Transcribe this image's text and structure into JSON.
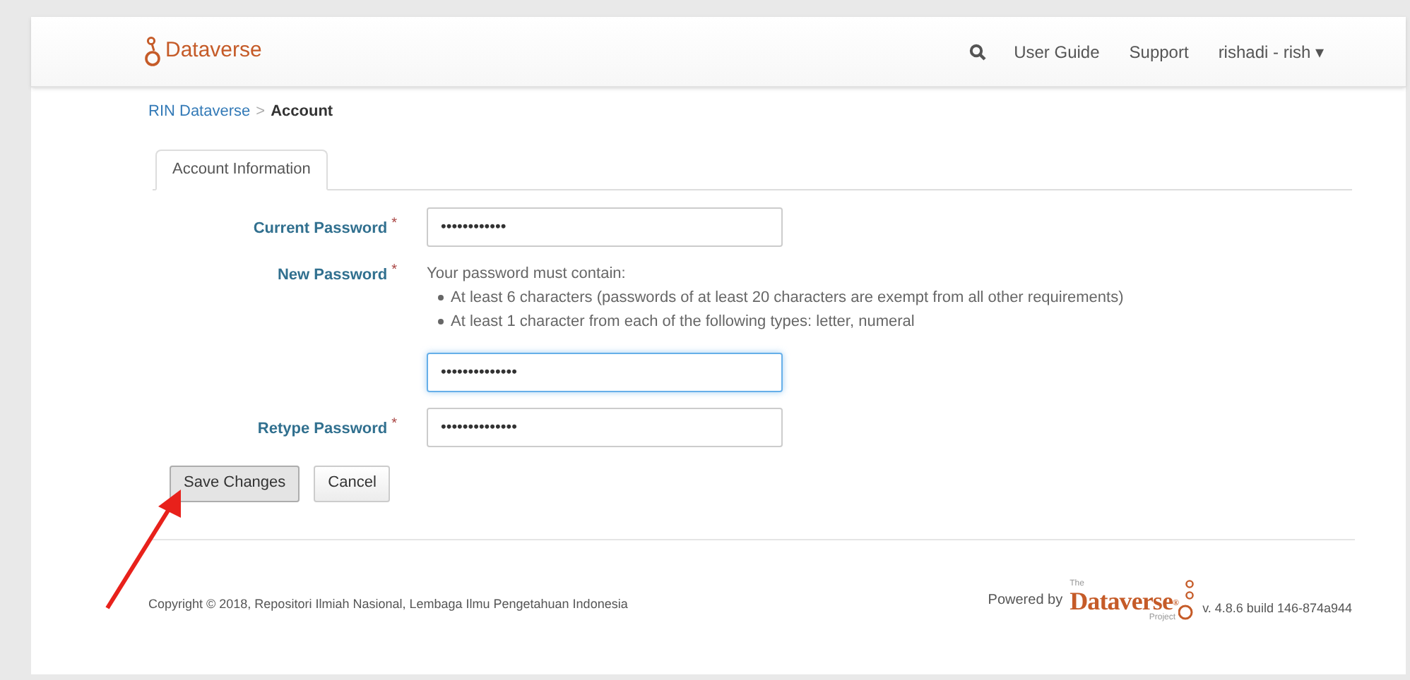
{
  "navbar": {
    "brand": "Dataverse",
    "links": [
      {
        "label": "User Guide"
      },
      {
        "label": "Support"
      }
    ],
    "user": {
      "label": "rishadi - rish",
      "caret": "▾"
    }
  },
  "breadcrumb": {
    "parent": "RIN Dataverse",
    "separator": ">",
    "current": "Account"
  },
  "tabs": [
    {
      "label": "Account Information",
      "selected": true
    }
  ],
  "form": {
    "fields": [
      {
        "label": "Current Password",
        "required": "*",
        "value": "••••••••••••",
        "focused": false
      },
      {
        "label": "New Password",
        "required": "*",
        "help_title": "Your password must contain:",
        "help_items": [
          "At least 6 characters (passwords of at least 20 characters are exempt from all other requirements)",
          "At least 1 character from each of the following types: letter, numeral"
        ],
        "value": "••••••••••••••",
        "focused": true
      },
      {
        "label": "Retype Password",
        "required": "*",
        "value": "••••••••••••••",
        "focused": false
      }
    ],
    "buttons": [
      {
        "label": "Save Changes",
        "hovered": true
      },
      {
        "label": "Cancel",
        "hovered": false
      }
    ]
  },
  "footer": {
    "copyright": "Copyright © 2018, Repositori Ilmiah Nasional, Lembaga Ilmu Pengetahuan Indonesia",
    "powered_by": "Powered by",
    "logo_small_top": "The",
    "logo_text": "Dataverse",
    "logo_reg": "®",
    "logo_small_bottom": "Project",
    "version": "v. 4.8.6 build 146-874a944"
  }
}
